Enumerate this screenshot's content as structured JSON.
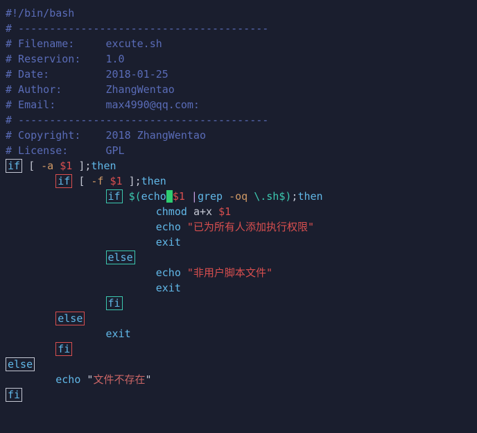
{
  "header": {
    "shebang": "#!/bin/bash",
    "dashline": "# ----------------------------------------",
    "filename_label": "# Filename:     ",
    "filename_value": "excute.sh",
    "reservion_label": "# Reservion:    ",
    "reservion_value": "1.0",
    "date_label": "# Date:         ",
    "date_value": "2018-01-25",
    "author_label": "# Author:       ",
    "author_value": "ZhangWentao",
    "email_label": "# Email:        ",
    "email_value": "max4990@qq.com:",
    "copyright_label": "# Copyright:    ",
    "copyright_value": "2018 ZhangWentao",
    "license_label": "# License:      ",
    "license_value": "GPL"
  },
  "code": {
    "if": "if",
    "else": "else",
    "fi": "fi",
    "lbr": "[",
    "rbr": "]",
    "semi": ";",
    "then": "then",
    "dash_a": "-a",
    "dash_f": "-f",
    "var1": "$1",
    "subst_open": "$(",
    "subst_close": ")",
    "echo_cmd": "echo",
    "space_cursor": " ",
    "pipe": "|",
    "grep": "grep",
    "grep_opts": "-oq",
    "regex": "\\.sh$",
    "chmod": "chmod",
    "chmod_arg": "a+x",
    "exit": "exit",
    "str1": "\"已为所有人添加执行权限\"",
    "str2": "\"非用户脚本文件\"",
    "str3_open": "\"",
    "str3_text": "文件不存在",
    "str3_close": "\""
  }
}
